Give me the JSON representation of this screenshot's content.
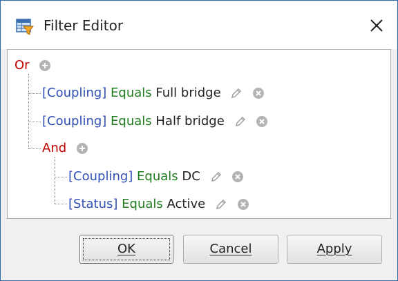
{
  "window": {
    "title": "Filter Editor"
  },
  "tree": {
    "root": {
      "op": "Or"
    },
    "cond1": {
      "field": "[Coupling]",
      "op": "Equals",
      "value": "Full bridge"
    },
    "cond2": {
      "field": "[Coupling]",
      "op": "Equals",
      "value": "Half bridge"
    },
    "group": {
      "op": "And"
    },
    "cond3": {
      "field": "[Coupling]",
      "op": "Equals",
      "value": "DC"
    },
    "cond4": {
      "field": "[Status]",
      "op": "Equals",
      "value": "Active"
    }
  },
  "buttons": {
    "ok": "OK",
    "cancel": "Cancel",
    "apply": "Apply"
  },
  "colors": {
    "group_operator": "#c00000",
    "field": "#2f4fb7",
    "condition_operator": "#1e7b1e",
    "border_accent": "#2b6cb0"
  },
  "icons": [
    "filter-table-icon",
    "close-icon",
    "add-icon",
    "edit-pencil-icon",
    "remove-icon"
  ]
}
